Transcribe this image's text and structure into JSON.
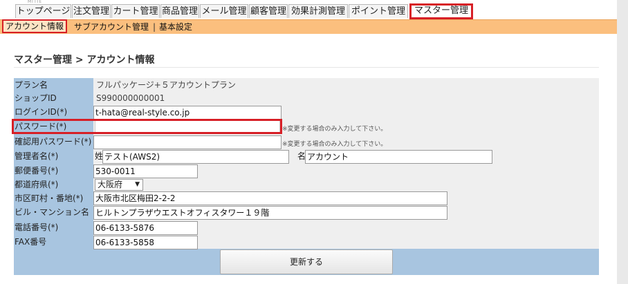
{
  "logo_text": "MITIE",
  "tabs": [
    {
      "label": "トップページ"
    },
    {
      "label": "注文管理"
    },
    {
      "label": "カート管理"
    },
    {
      "label": "商品管理"
    },
    {
      "label": "メール管理"
    },
    {
      "label": "顧客管理"
    },
    {
      "label": "効果計測管理"
    },
    {
      "label": "ポイント管理"
    },
    {
      "label": "マスター管理",
      "active": true
    }
  ],
  "subnav": {
    "account_info": "アカウント情報",
    "sub_account": "サブアカウント管理",
    "separator": "|",
    "basic_settings": "基本設定"
  },
  "page_title": "マスター管理 > アカウント情報",
  "form": {
    "plan": {
      "label": "プラン名",
      "value": "フルパッケージ+５アカウントプラン"
    },
    "shop_id": {
      "label": "ショップID",
      "value": "S990000000001"
    },
    "login_id": {
      "label": "ログインID(*)",
      "value": "t-hata@real-style.co.jp"
    },
    "password": {
      "label": "パスワード(*)",
      "value": "",
      "note": "※変更する場合のみ入力して下さい。"
    },
    "password_confirm": {
      "label": "確認用パスワード(*)",
      "value": "",
      "note": "※変更する場合のみ入力して下さい。"
    },
    "manager": {
      "label": "管理者名(*)",
      "sei_label": "姓",
      "sei_value": "テスト(AWS2)",
      "mei_label": "名",
      "mei_value": "アカウント"
    },
    "postal": {
      "label": "郵便番号(*)",
      "value": "530-0011"
    },
    "prefecture": {
      "label": "都道府県(*)",
      "value": "大阪府"
    },
    "city": {
      "label": "市区町村・番地(*)",
      "value": "大阪市北区梅田2-2-2"
    },
    "building": {
      "label": "ビル・マンション名",
      "value": "ヒルトンプラザウエストオフィスタワー１９階"
    },
    "phone": {
      "label": "電話番号(*)",
      "value": "06-6133-5876"
    },
    "fax": {
      "label": "FAX番号",
      "value": "06-6133-5858"
    }
  },
  "submit_label": "更新する",
  "colors": {
    "highlight": "#d71f26",
    "subnav_bg": "#fbbf7e",
    "label_bg": "#a8c5e0",
    "value_bg": "#efefef"
  }
}
